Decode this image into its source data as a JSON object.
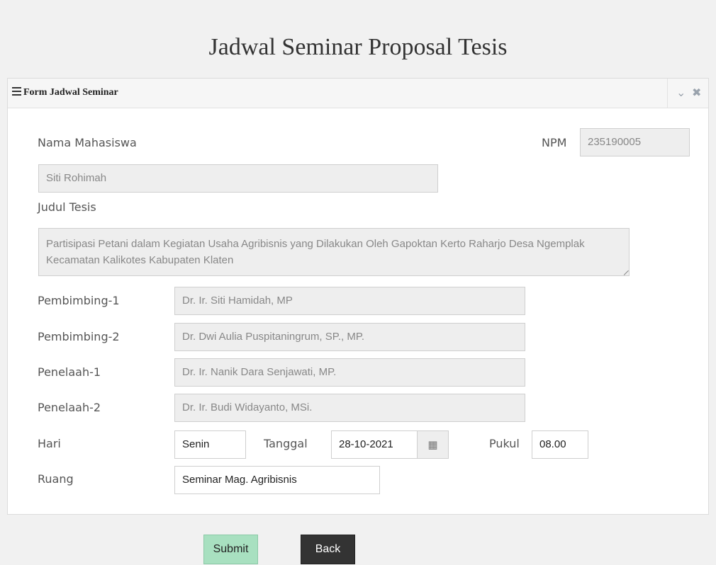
{
  "page": {
    "title": "Jadwal Seminar Proposal Tesis"
  },
  "panel": {
    "title": "Form Jadwal Seminar",
    "tools": {
      "collapse_icon": "chevron-down-icon",
      "close_icon": "close-icon"
    }
  },
  "form": {
    "nama_label": "Nama Mahasiswa",
    "nama_value": "Siti Rohimah",
    "npm_label": "NPM",
    "npm_value": "235190005",
    "judul_label": "Judul Tesis",
    "judul_value": "Partisipasi Petani dalam Kegiatan Usaha Agribisnis yang Dilakukan Oleh Gapoktan Kerto Raharjo Desa Ngemplak Kecamatan Kalikotes Kabupaten Klaten",
    "pembimbing1_label": "Pembimbing-1",
    "pembimbing1_value": "Dr. Ir. Siti Hamidah, MP",
    "pembimbing2_label": "Pembimbing-2",
    "pembimbing2_value": "Dr. Dwi Aulia Puspitaningrum, SP.,  MP.",
    "penelaah1_label": "Penelaah-1",
    "penelaah1_value": "Dr. Ir. Nanik Dara Senjawati, MP.",
    "penelaah2_label": "Penelaah-2",
    "penelaah2_value": "Dr. Ir. Budi Widayanto, MSi.",
    "hari_label": "Hari",
    "hari_value": "Senin",
    "tanggal_label": "Tanggal",
    "tanggal_value": "28-10-2021",
    "pukul_label": "Pukul",
    "pukul_value": "08.00",
    "ruang_label": "Ruang",
    "ruang_value": "Seminar Mag. Agribisnis"
  },
  "buttons": {
    "submit": "Submit",
    "back": "Back"
  }
}
